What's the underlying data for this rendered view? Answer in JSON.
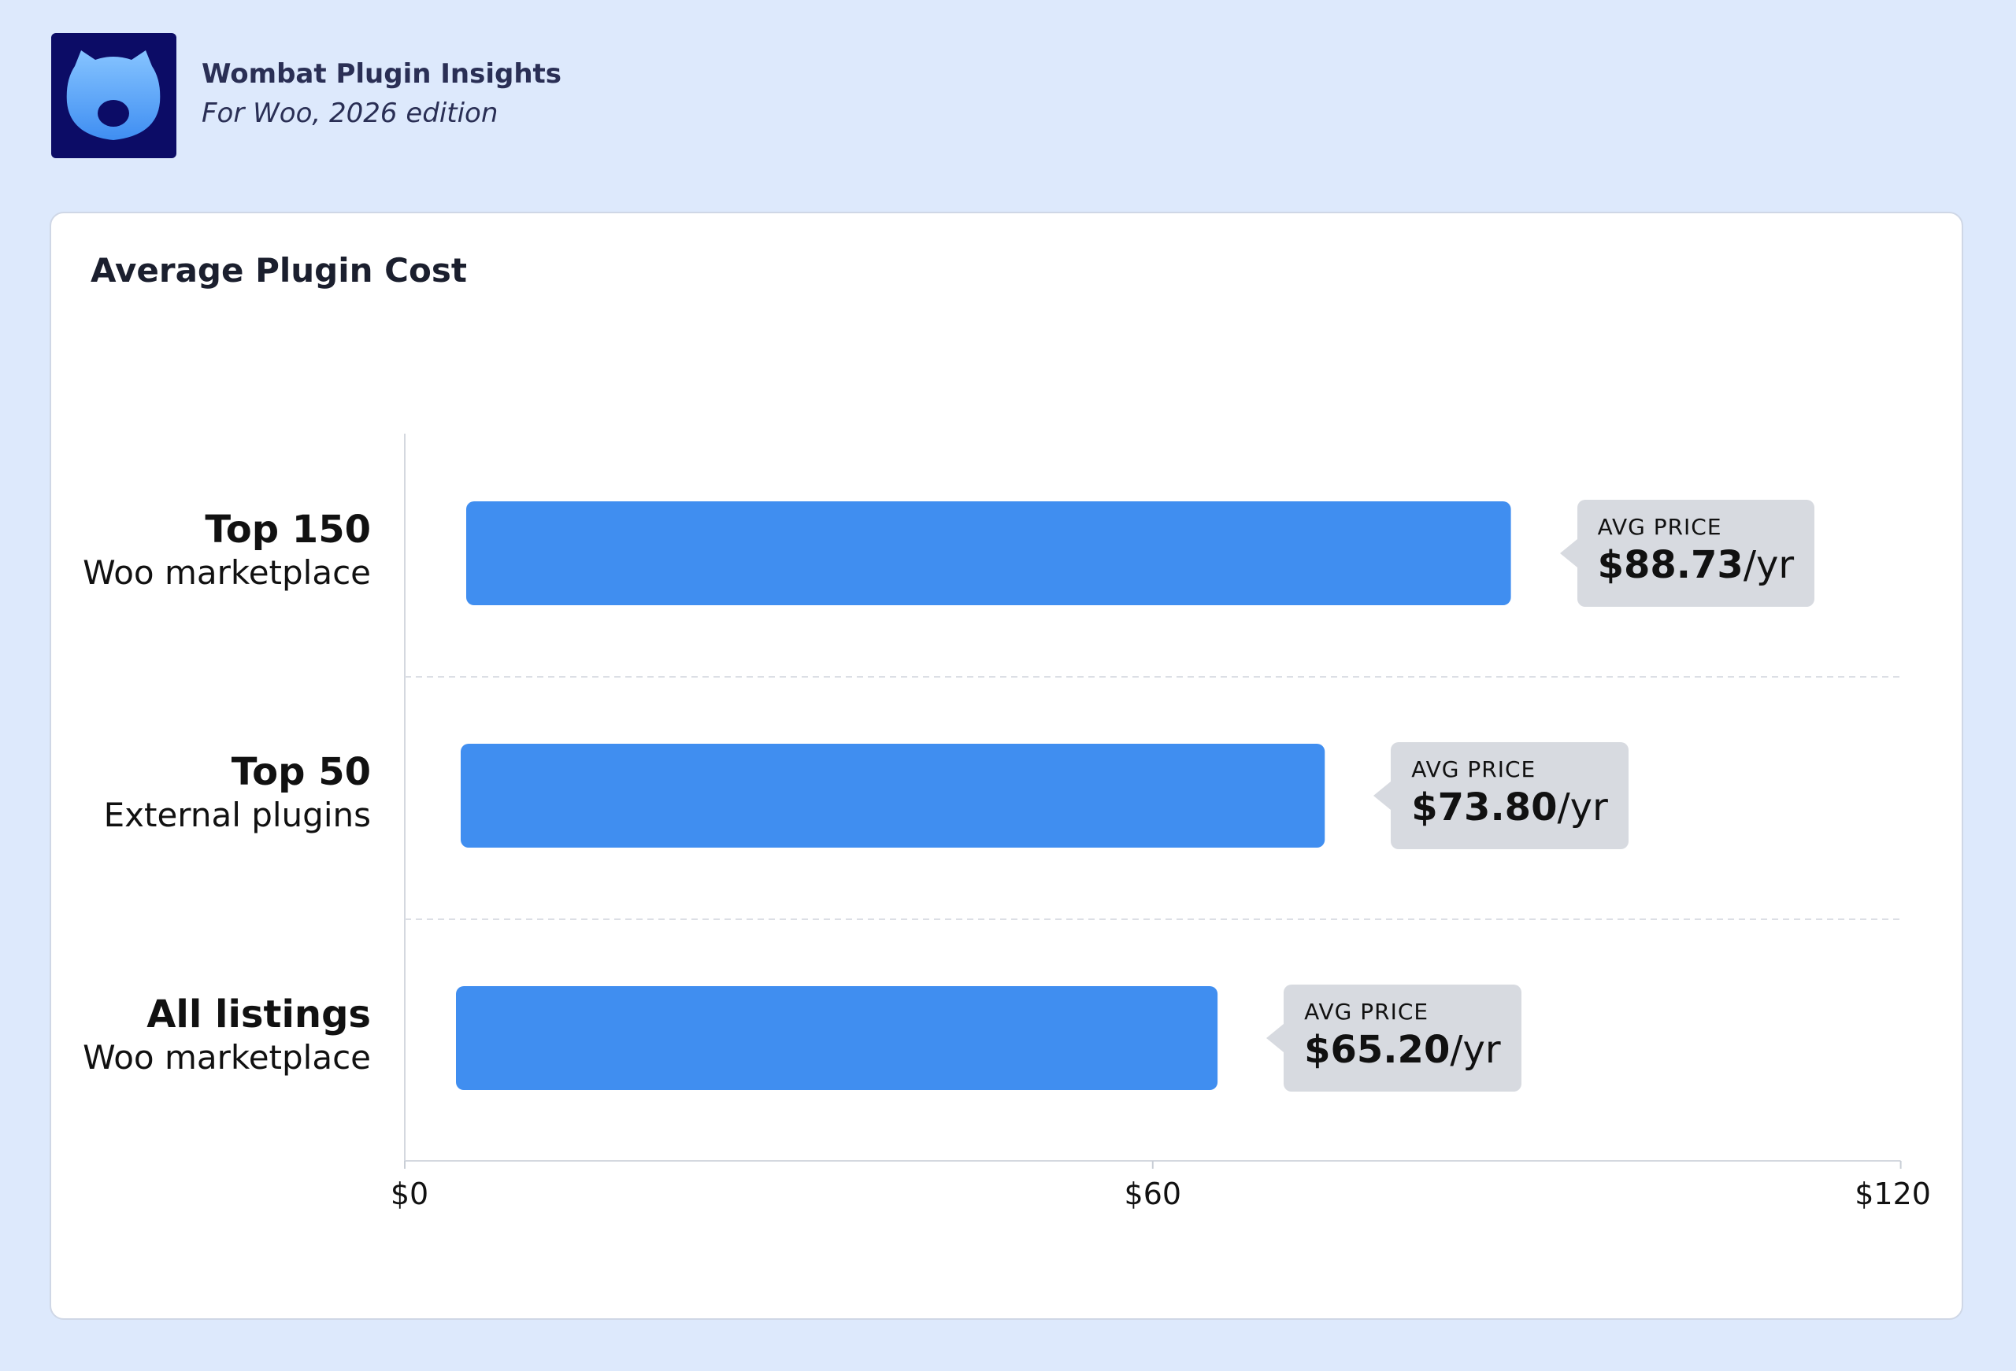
{
  "header": {
    "logo_icon": "wombat-icon",
    "title": "Wombat Plugin Insights",
    "subtitle": "For Woo, 2026 edition"
  },
  "colors": {
    "page_bg": "#dde9fc",
    "bar": "#408ef0",
    "callout_bg": "#d7dae0",
    "logo_bg": "#0c0c66"
  },
  "chart_data": {
    "type": "bar",
    "orientation": "horizontal",
    "title": "Average Plugin Cost",
    "categories": [
      {
        "name": "Top 150",
        "sub": "Woo marketplace"
      },
      {
        "name": "Top 50",
        "sub": "External plugins"
      },
      {
        "name": "All listings",
        "sub": "Woo marketplace"
      }
    ],
    "values": [
      88.73,
      73.8,
      65.2
    ],
    "value_caption": "AVG PRICE",
    "value_labels": [
      "$88.73",
      "$73.80",
      "$65.20"
    ],
    "value_unit": "/yr",
    "xlim": [
      0,
      120
    ],
    "xticks": [
      0,
      60,
      120
    ],
    "xtick_labels": [
      "$0",
      "$60",
      "$120"
    ],
    "grid": "dashed horizontal separators between bars"
  }
}
